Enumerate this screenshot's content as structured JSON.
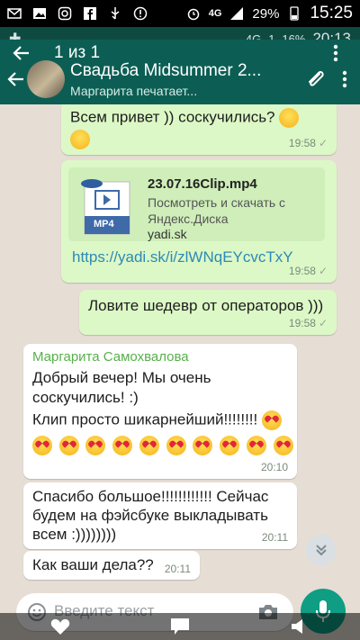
{
  "status": {
    "network": "4G",
    "battery": "29%",
    "time": "15:25"
  },
  "inner_status": {
    "network": "4G",
    "signal": "1",
    "battery": "16%",
    "time": "20:13"
  },
  "overlay": {
    "count": "1 из 1"
  },
  "header": {
    "title": "Свадьба Midsummer 2...",
    "subtitle": "Маргарита печатает..."
  },
  "messages": {
    "m1": {
      "text": "Всем привет )) соскучились?",
      "time": "19:58"
    },
    "m2": {
      "file_name": "23.07.16Clip.mp4",
      "file_desc": "Посмотреть и скачать с Яндекс.Диска",
      "file_domain": "yadi.sk",
      "file_badge": "MP4",
      "link": "https://yadi.sk/i/zlWNqEYcvcTxY",
      "time": "19:58"
    },
    "m3": {
      "text": "Ловите шедевр от операторов )))",
      "time": "19:58"
    },
    "m4": {
      "sender": "Маргарита Самохвалова",
      "line1": "Добрый вечер! Мы очень",
      "line2": "соскучились! :)",
      "line3": "Клип просто шикарнейший!!!!!!!!",
      "time": "20:10"
    },
    "m5": {
      "line1": "Спасибо большое!!!!!!!!!!!! Сейчас",
      "line2": "будем на фэйсбуке выкладывать",
      "line3": "всем :))))))))",
      "time": "20:11"
    },
    "m6": {
      "text": "Как ваши дела??",
      "time": "20:11"
    }
  },
  "input": {
    "placeholder": "Введите текст"
  },
  "colors": {
    "header": "#0c5e54",
    "outgoing": "#dcf8c6",
    "incoming": "#ffffff",
    "accent": "#0f9d84"
  }
}
